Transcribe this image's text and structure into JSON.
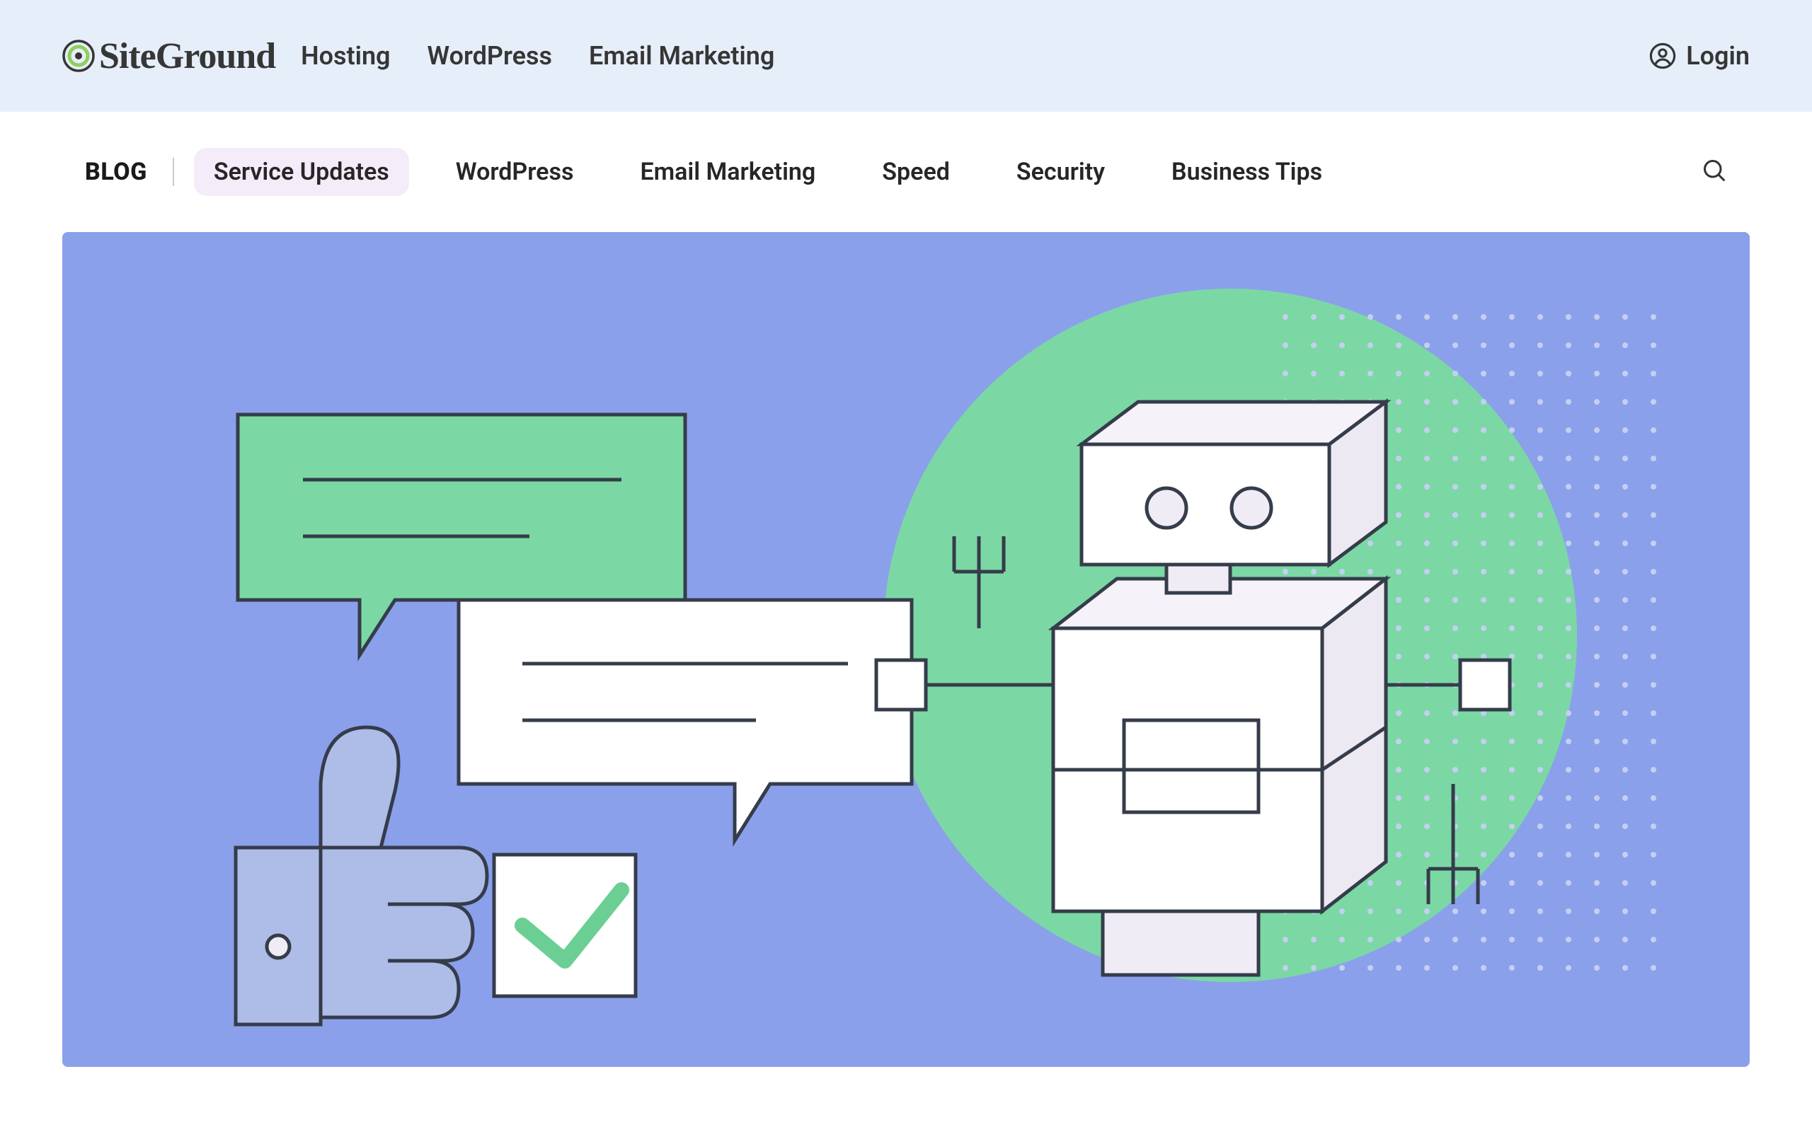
{
  "brand": "SiteGround",
  "primaryNav": {
    "hosting": "Hosting",
    "wordpress": "WordPress",
    "email": "Email Marketing"
  },
  "login": "Login",
  "blogLabel": "BLOG",
  "subNav": {
    "serviceUpdates": "Service Updates",
    "wordpress": "WordPress",
    "emailMarketing": "Email Marketing",
    "speed": "Speed",
    "security": "Security",
    "businessTips": "Business Tips"
  },
  "activeTab": "serviceUpdates",
  "colors": {
    "headerBg": "#e6eff9",
    "heroBg": "#8ba0eb",
    "accentGreen": "#7bd8a4",
    "activePillBg": "#f4ecf9",
    "thumbsBlue": "#aebce8",
    "logoGreen": "#8fcf5c"
  }
}
